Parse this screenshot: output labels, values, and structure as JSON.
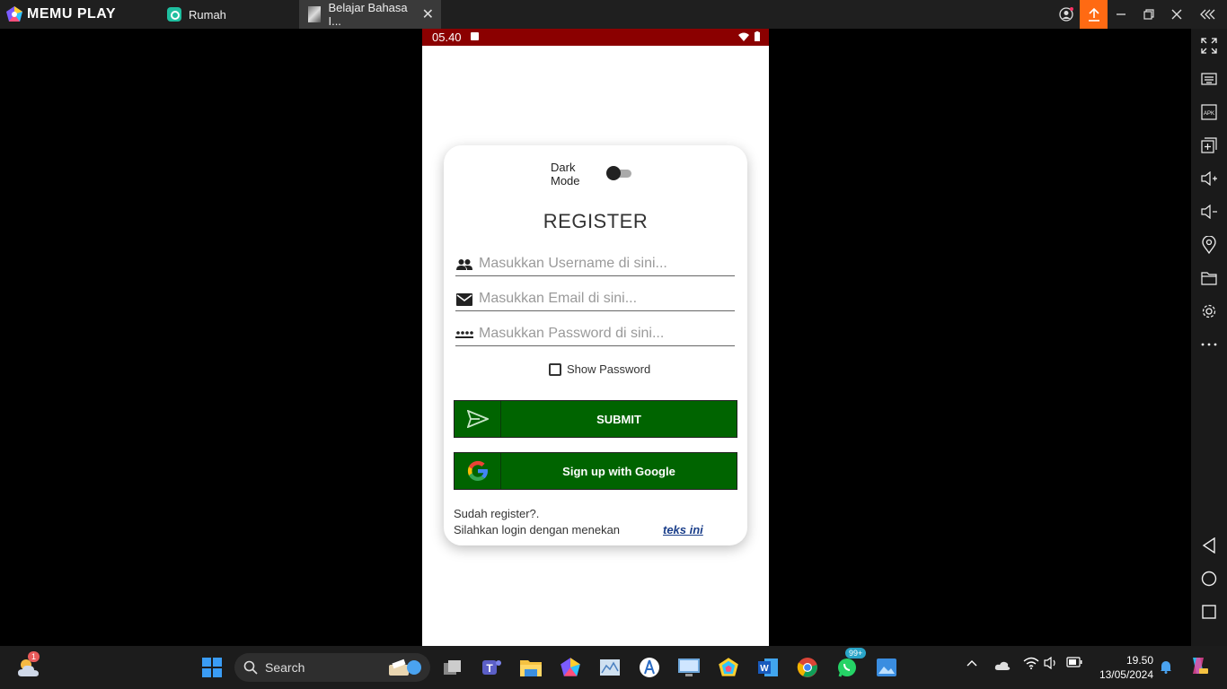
{
  "window": {
    "brand": "MEMU PLAY",
    "tabs": [
      {
        "label": "Rumah"
      },
      {
        "label": "Belajar Bahasa I..."
      }
    ]
  },
  "status_bar": {
    "time": "05.40"
  },
  "form": {
    "dark_mode_label": "Dark Mode",
    "dark_mode_on": false,
    "title": "REGISTER",
    "username_placeholder": "Masukkan Username di sini...",
    "email_placeholder": "Masukkan Email di sini...",
    "password_placeholder": "Masukkan Password di sini...",
    "show_password_label": "Show Password",
    "submit_label": "SUBMIT",
    "google_label": "Sign up with Google",
    "footer_line1": "Sudah register?.",
    "footer_line2": "Silahkan login dengan menekan",
    "footer_link": "teks ini"
  },
  "taskbar": {
    "search_placeholder": "Search",
    "weather_badge": "1",
    "whatsapp_badge": "99+",
    "time": "19.50",
    "date": "13/05/2024"
  },
  "colors": {
    "status_bar": "#8b0000",
    "button_green": "#006400",
    "upload_orange": "#ff6a13"
  }
}
